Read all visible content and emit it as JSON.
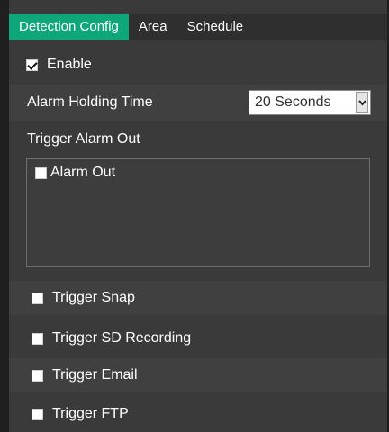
{
  "tabs": [
    {
      "label": "Detection Config",
      "active": true
    },
    {
      "label": "Area",
      "active": false
    },
    {
      "label": "Schedule",
      "active": false
    }
  ],
  "enable": {
    "label": "Enable",
    "checked": true
  },
  "alarm_holding": {
    "label": "Alarm Holding Time",
    "selected": "20 Seconds"
  },
  "trigger_alarm_out": {
    "label": "Trigger Alarm Out",
    "items": [
      {
        "label": "Alarm Out",
        "checked": false
      }
    ]
  },
  "triggers": [
    {
      "label": "Trigger Snap",
      "checked": false
    },
    {
      "label": "Trigger SD Recording",
      "checked": false
    },
    {
      "label": "Trigger Email",
      "checked": false
    },
    {
      "label": "Trigger FTP",
      "checked": false
    }
  ],
  "colors": {
    "accent": "#0ea77a",
    "panel": "#3a3a3a",
    "row_dark": "#404040"
  }
}
